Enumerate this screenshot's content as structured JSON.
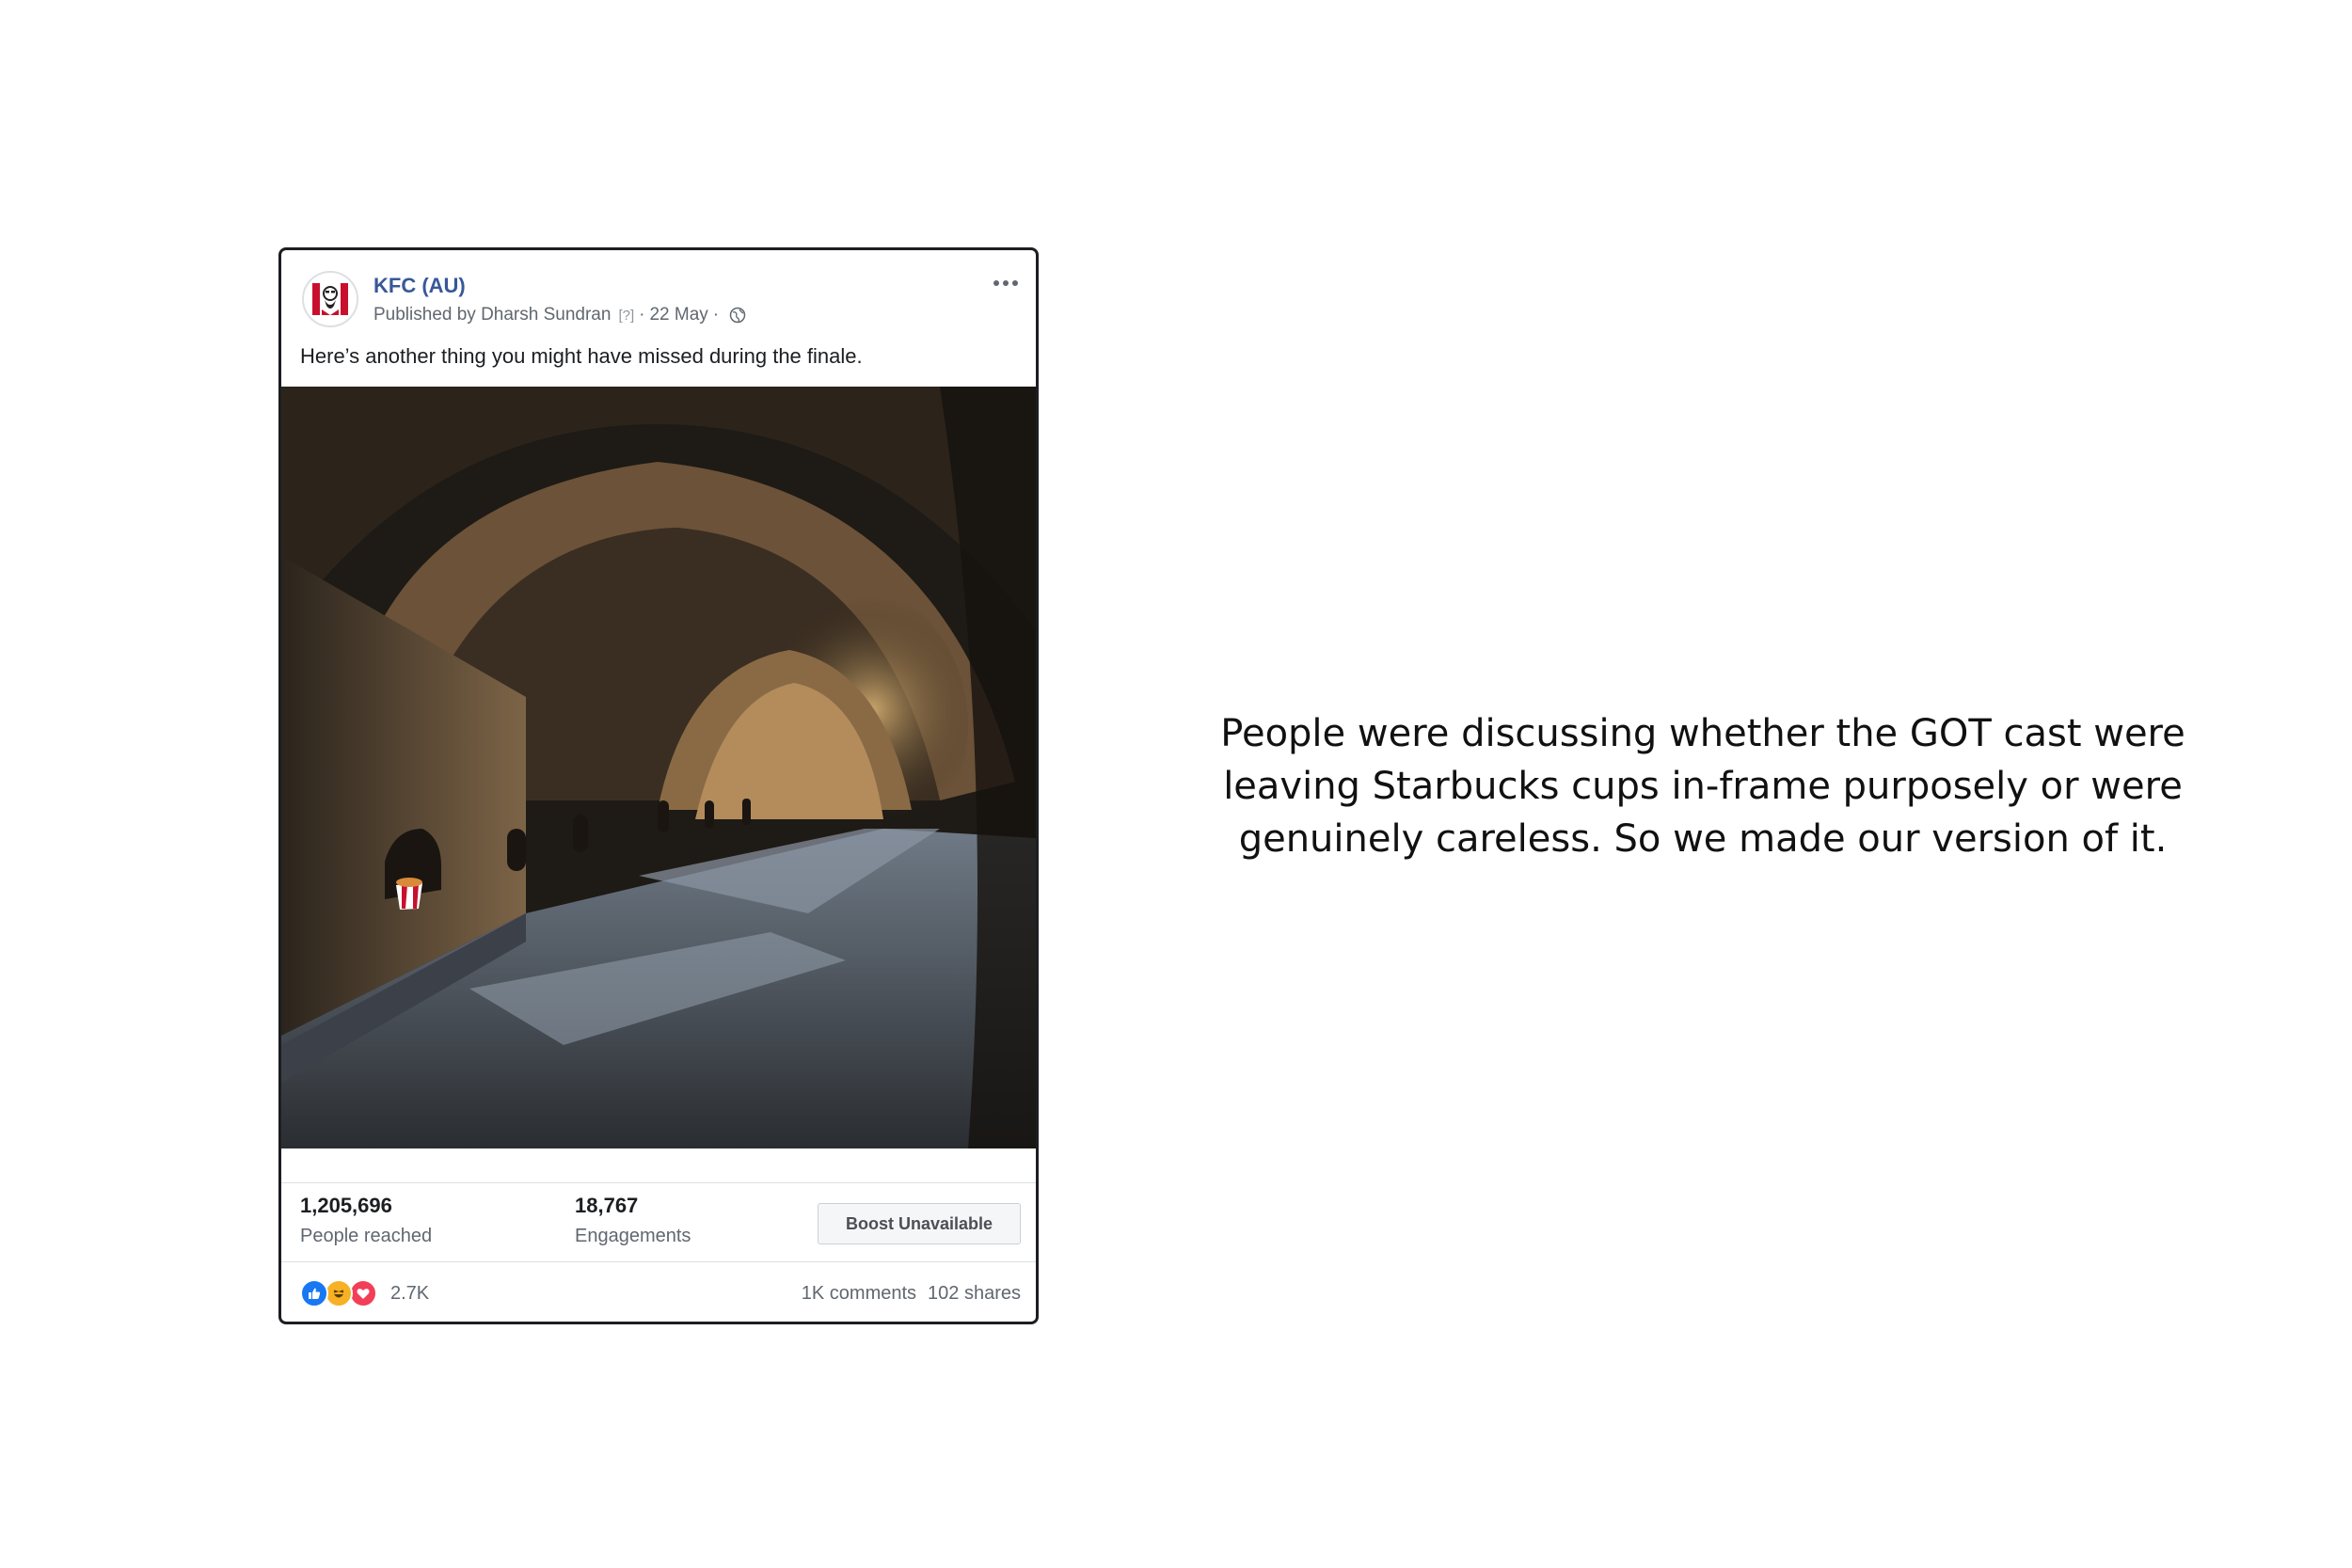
{
  "post": {
    "page_name": "KFC (AU)",
    "published_by": "Published by Dharsh Sundran",
    "help_marker": "[?]",
    "separator": "·",
    "date": "22 May",
    "text": "Here’s another thing you might have missed during the finale.",
    "more_icon": "more-horizontal-icon",
    "avatar_icon": "kfc-logo-icon",
    "privacy_icon": "globe-icon"
  },
  "insights": {
    "people_reached_value": "1,205,696",
    "people_reached_label": "People reached",
    "engagements_value": "18,767",
    "engagements_label": "Engagements",
    "boost_label": "Boost Unavailable"
  },
  "feedback": {
    "reaction_icons": [
      "like-icon",
      "haha-icon",
      "love-icon"
    ],
    "reaction_count": "2.7K",
    "comments": "1K comments",
    "shares": "102 shares"
  },
  "caption": {
    "text": "People were discussing whether the GOT cast were leaving Starbucks cups in-frame purposely or were genuinely careless. So we made our version of it."
  },
  "colors": {
    "link_blue": "#385898",
    "like_blue": "#1877f2",
    "love_red": "#f33e58",
    "haha_yellow": "#f7b125",
    "kfc_red": "#c8102e"
  }
}
